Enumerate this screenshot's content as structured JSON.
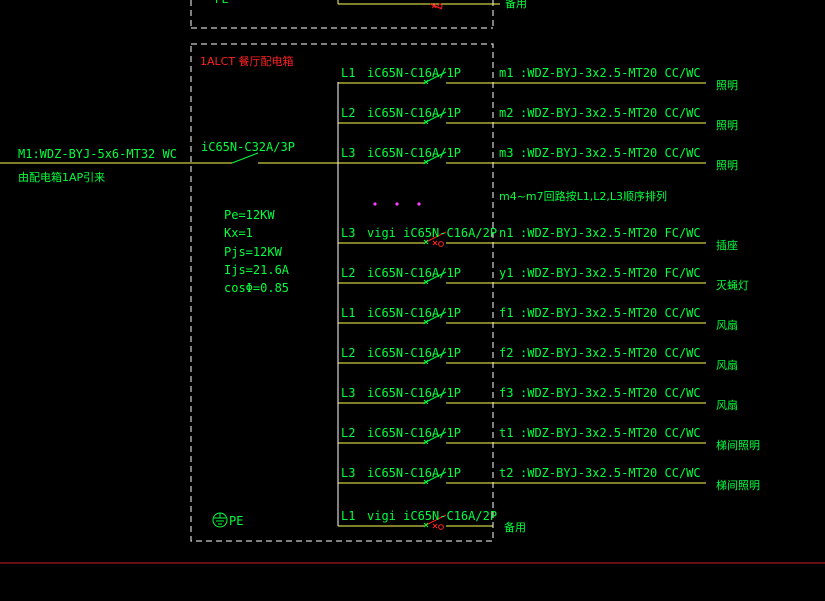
{
  "panel": {
    "title": "1ALCT 餐厅配电箱",
    "pe_label": "PE",
    "upper_spare": "备用"
  },
  "incoming": {
    "cable": "M1:WDZ-BYJ-5x6-MT32 WC",
    "source": "由配电箱1AP引来",
    "breaker": "iC65N-C32A/3P"
  },
  "params": [
    "Pe=12KW",
    "Kx=1",
    "Pjs=12KW",
    "Ijs=21.6A",
    "cosΦ=0.85"
  ],
  "note": "m4~m7回路按L1,L2,L3顺序排列",
  "circuits": [
    {
      "phase": "L1",
      "breaker": "iC65N-C16A/1P",
      "id": "m1",
      "cable": ":WDZ-BYJ-3x2.5-MT20 CC/WC",
      "load": "照明",
      "rcd": false
    },
    {
      "phase": "L2",
      "breaker": "iC65N-C16A/1P",
      "id": "m2",
      "cable": ":WDZ-BYJ-3x2.5-MT20 CC/WC",
      "load": "照明",
      "rcd": false
    },
    {
      "phase": "L3",
      "breaker": "iC65N-C16A/1P",
      "id": "m3",
      "cable": ":WDZ-BYJ-3x2.5-MT20 CC/WC",
      "load": "照明",
      "rcd": false
    },
    {
      "phase": "L3",
      "breaker": "vigi iC65N-C16A/2P",
      "id": "n1",
      "cable": ":WDZ-BYJ-3x2.5-MT20 FC/WC",
      "load": "插座",
      "rcd": true
    },
    {
      "phase": "L2",
      "breaker": "iC65N-C16A/1P",
      "id": "y1",
      "cable": ":WDZ-BYJ-3x2.5-MT20 FC/WC",
      "load": "灭蝇灯",
      "rcd": false
    },
    {
      "phase": "L1",
      "breaker": "iC65N-C16A/1P",
      "id": "f1",
      "cable": ":WDZ-BYJ-3x2.5-MT20 CC/WC",
      "load": "风扇",
      "rcd": false
    },
    {
      "phase": "L2",
      "breaker": "iC65N-C16A/1P",
      "id": "f2",
      "cable": ":WDZ-BYJ-3x2.5-MT20 CC/WC",
      "load": "风扇",
      "rcd": false
    },
    {
      "phase": "L3",
      "breaker": "iC65N-C16A/1P",
      "id": "f3",
      "cable": ":WDZ-BYJ-3x2.5-MT20 CC/WC",
      "load": "风扇",
      "rcd": false
    },
    {
      "phase": "L2",
      "breaker": "iC65N-C16A/1P",
      "id": "t1",
      "cable": ":WDZ-BYJ-3x2.5-MT20 CC/WC",
      "load": "梯间照明",
      "rcd": false
    },
    {
      "phase": "L3",
      "breaker": "iC65N-C16A/1P",
      "id": "t2",
      "cable": ":WDZ-BYJ-3x2.5-MT20 CC/WC",
      "load": "梯间照明",
      "rcd": false
    },
    {
      "phase": "L1",
      "breaker": "vigi iC65N-C16A/2P",
      "id": "",
      "cable": "",
      "load": "备用",
      "rcd": true
    }
  ],
  "colors": {
    "background": "#000000",
    "text_green": "#00ff3c",
    "wire_yellow": "#ffff55",
    "rcd_red": "#ff2020",
    "boundary_red": "#c81e2d",
    "dots_magenta": "#ff3cff"
  }
}
